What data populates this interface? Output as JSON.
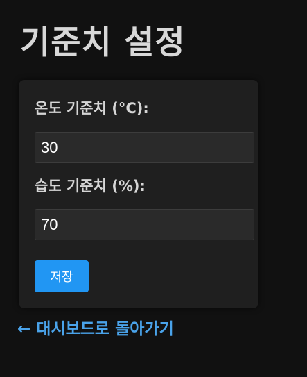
{
  "page": {
    "title": "기준치 설정"
  },
  "form": {
    "temperature_label": "온도 기준치 (°C):",
    "temperature_value": "30",
    "humidity_label": "습도 기준치 (%):",
    "humidity_value": "70",
    "save_label": "저장"
  },
  "nav": {
    "back_label": "← 대시보드로 돌아가기"
  },
  "colors": {
    "background": "#111111",
    "card": "#1f1f1f",
    "accent": "#2196f3",
    "link": "#4aa3ea"
  }
}
